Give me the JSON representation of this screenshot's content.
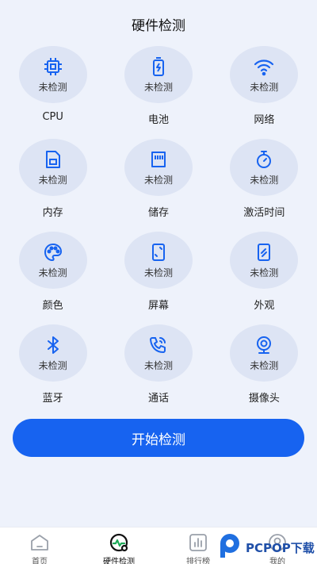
{
  "header": {
    "title": "硬件检测"
  },
  "status_text": "未检测",
  "accent_color": "#1763f0",
  "items": [
    {
      "label": "CPU",
      "icon": "cpu-icon"
    },
    {
      "label": "电池",
      "icon": "battery-icon"
    },
    {
      "label": "网络",
      "icon": "wifi-icon"
    },
    {
      "label": "内存",
      "icon": "memory-icon"
    },
    {
      "label": "储存",
      "icon": "sd-card-icon"
    },
    {
      "label": "激活时间",
      "icon": "stopwatch-icon"
    },
    {
      "label": "颜色",
      "icon": "palette-icon"
    },
    {
      "label": "屏幕",
      "icon": "screen-icon"
    },
    {
      "label": "外观",
      "icon": "appearance-icon"
    },
    {
      "label": "蓝牙",
      "icon": "bluetooth-icon"
    },
    {
      "label": "通话",
      "icon": "phone-call-icon"
    },
    {
      "label": "摄像头",
      "icon": "webcam-icon"
    }
  ],
  "start_button": {
    "label": "开始检测"
  },
  "tabs": [
    {
      "label": "首页",
      "icon": "home-icon"
    },
    {
      "label": "硬件检测",
      "icon": "hardware-check-icon",
      "active": true
    },
    {
      "label": "排行榜",
      "icon": "ranking-icon"
    },
    {
      "label": "我的",
      "icon": "profile-icon"
    }
  ],
  "watermark": {
    "text": "PCPOP下载"
  }
}
